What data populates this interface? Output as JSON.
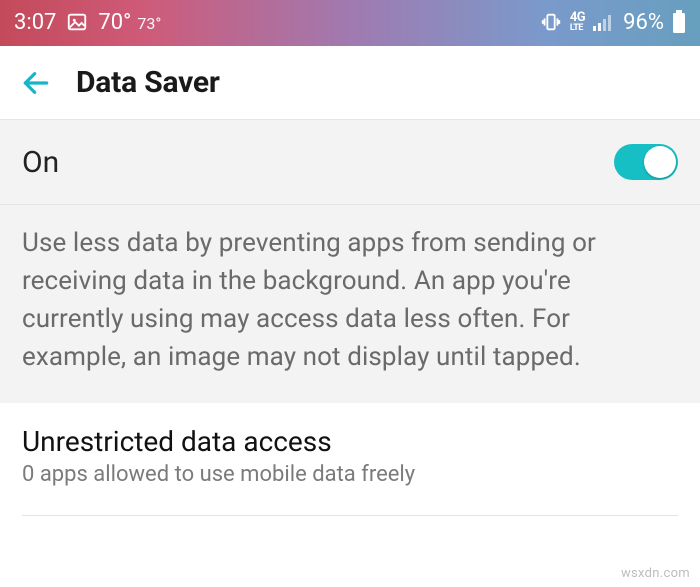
{
  "status": {
    "time": "3:07",
    "temp_hi": "70°",
    "temp_lo": "73°",
    "network_label": "4G LTE",
    "battery_pct": "96%"
  },
  "header": {
    "title": "Data Saver"
  },
  "toggle": {
    "label": "On",
    "state": "true"
  },
  "description": "Use less data by preventing apps from sending or receiving data in the background. An app you're currently using may access data less often. For example, an image may not display until tapped.",
  "unrestricted": {
    "title": "Unrestricted data access",
    "subtitle": "0 apps allowed to use mobile data freely"
  },
  "watermark": "wsxdn.com"
}
